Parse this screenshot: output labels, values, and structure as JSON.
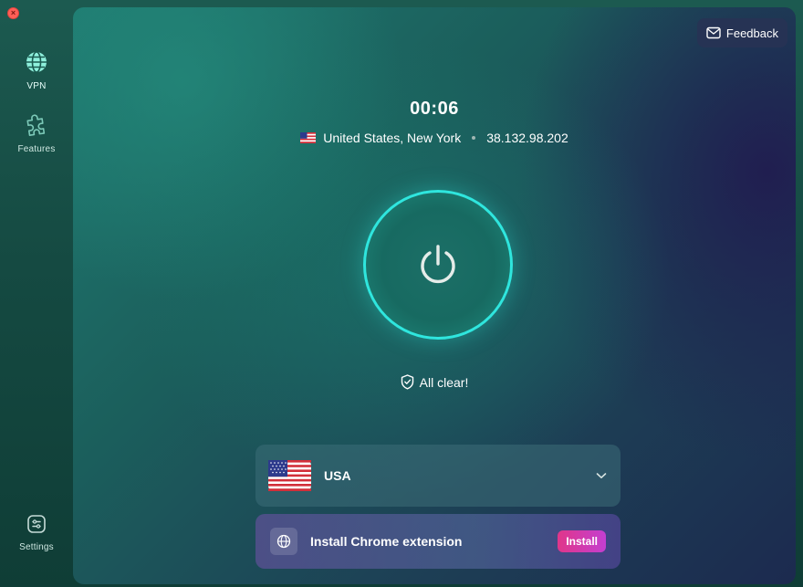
{
  "window": {
    "close_glyph": "×"
  },
  "sidebar": {
    "items": [
      {
        "label": "VPN",
        "icon": "globe-icon",
        "active": true
      },
      {
        "label": "Features",
        "icon": "puzzle-icon",
        "active": false
      },
      {
        "label": "Settings",
        "icon": "settings-icon",
        "active": false
      }
    ]
  },
  "header": {
    "feedback_label": "Feedback",
    "feedback_icon": "mail-icon"
  },
  "connection": {
    "timer": "00:06",
    "location": "United States, New York",
    "ip": "38.132.98.202",
    "status": "All clear!"
  },
  "server": {
    "country": "USA"
  },
  "extension": {
    "title": "Install Chrome extension",
    "button_label": "Install"
  },
  "colors": {
    "accent": "#2fe6de",
    "install_gradient_start": "#e0368a",
    "install_gradient_end": "#c43fd0"
  }
}
